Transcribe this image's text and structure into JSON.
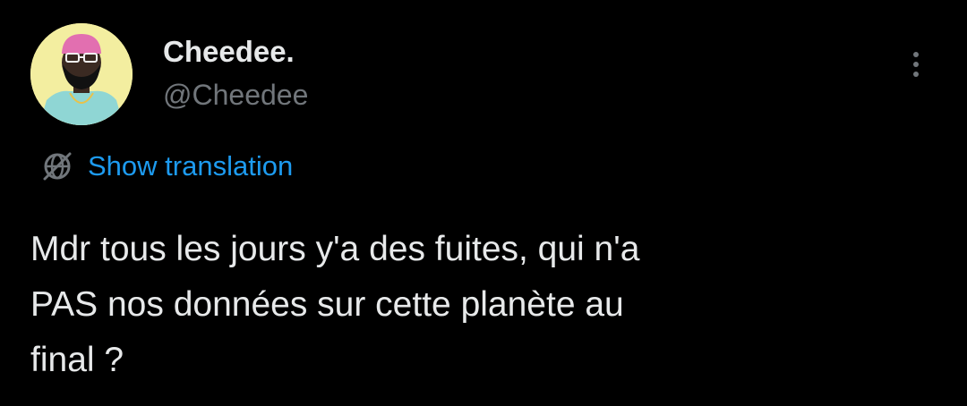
{
  "author": {
    "display_name": "Cheedee.",
    "handle": "@Cheedee",
    "avatar_icon": "avatar-illustration"
  },
  "actions": {
    "more_icon": "more-vertical-icon",
    "translate_icon": "globe-icon",
    "translate_label": "Show translation"
  },
  "tweet": {
    "lines": [
      "Mdr tous les jours y'a des fuites, qui n'a",
      "PAS nos données sur cette planète au",
      "final ?"
    ]
  },
  "colors": {
    "background": "#000000",
    "primary_text": "#e7e9ea",
    "secondary_text": "#71767b",
    "accent": "#1d9bf0"
  }
}
